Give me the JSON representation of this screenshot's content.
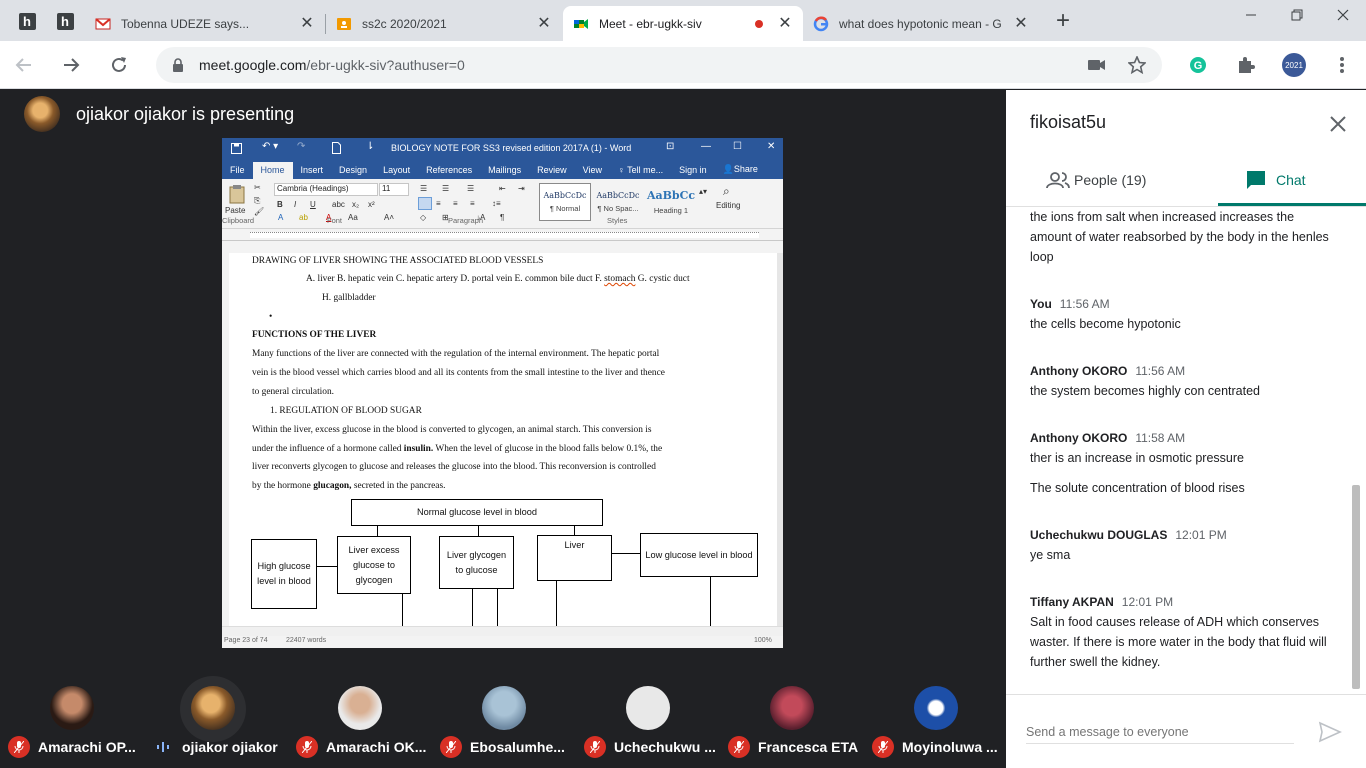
{
  "browser": {
    "pinned_tabs": [
      {
        "letter": "h"
      },
      {
        "letter": "h"
      }
    ],
    "tabs": [
      {
        "title": "Tobenna UDEZE says...",
        "icon": "gmail-icon"
      },
      {
        "title": "ss2c 2020/2021",
        "icon": "classroom-icon"
      },
      {
        "title": "Meet - ebr-ugkk-siv",
        "icon": "meet-icon",
        "active": true,
        "recording": true
      },
      {
        "title": "what does hypotonic mean - G",
        "icon": "google-icon"
      }
    ],
    "url_host": "meet.google.com",
    "url_path": "/ebr-ugkk-siv?authuser=0",
    "profile_label": "2021"
  },
  "meet": {
    "presenter_text": "ojiakor ojiakor is presenting",
    "participants": [
      {
        "name": "Amarachi OP...",
        "muted": true
      },
      {
        "name": "ojiakor ojiakor",
        "muted": false
      },
      {
        "name": "Amarachi OK...",
        "muted": true
      },
      {
        "name": "Ebosalumhe...",
        "muted": true
      },
      {
        "name": "Uchechukwu ...",
        "muted": true
      },
      {
        "name": "Francesca ETA",
        "muted": true
      },
      {
        "name": "Moyinoluwa ...",
        "muted": true
      }
    ]
  },
  "word": {
    "title": "BIOLOGY NOTE  FOR SS3 revised edition 2017A (1) - Word",
    "tabs": [
      "File",
      "Home",
      "Insert",
      "Design",
      "Layout",
      "References",
      "Mailings",
      "Review",
      "View"
    ],
    "tell_me": "Tell me...",
    "sign_in": "Sign in",
    "share": "Share",
    "font_name": "Cambria (Headings)",
    "font_size": "11",
    "groups": {
      "clipboard": "Clipboard",
      "font": "Font",
      "paragraph": "Paragraph",
      "styles": "Styles"
    },
    "paste": "Paste",
    "editing": "Editing",
    "styles": [
      {
        "sample": "AaBbCcDc",
        "name": "¶ Normal"
      },
      {
        "sample": "AaBbCcDc",
        "name": "¶ No Spac..."
      },
      {
        "sample": "AaBbCc",
        "name": "Heading 1"
      }
    ],
    "status_page": "Page 23 of 74",
    "status_words": "22407 words",
    "status_zoom": "100%",
    "doc": {
      "heading1": "DRAWING OF LIVER SHOWING THE ASSOCIATED BLOOD VESSELS",
      "list_a_1": "A.    liver B. hepatic vein C. hepatic artery D. portal vein E. common bile duct F. ",
      "list_a_stomach": "stomach",
      "list_a_2": " G. cystic duct",
      "list_a_3": "H. gallbladder",
      "bullet": "•",
      "functions_heading": "FUNCTIONS OF THE LIVER",
      "para1_l1": "Many functions of the liver are connected with the regulation of the internal environment. The hepatic portal",
      "para1_l2": "vein is the blood vessel which carries blood and all its contents from the small intestine to the liver and thence",
      "para1_l3": "to general circulation.",
      "sub_heading": "1.    REGULATION OF BLOOD SUGAR",
      "para2_l1": "Within the liver, excess glucose in the blood is converted to glycogen, an animal starch. This conversion is",
      "para2_l2a": "under the influence of a hormone called ",
      "para2_l2b": "insulin.",
      "para2_l2c": " When the level of glucose in the blood falls below 0.1%, the",
      "para2_l3": "liver reconverts glycogen to glucose and releases the glucose into the blood.  This reconversion is controlled",
      "para2_l4a": "by the hormone ",
      "para2_l4b": "glucagon,",
      "para2_l4c": " secreted in the pancreas.",
      "flow": {
        "normal": "Normal glucose level in blood",
        "high": "High glucose level in blood",
        "excess": "Liver excess glucose to glycogen",
        "glycogen": "Liver glycogen to glucose",
        "liver": "Liver",
        "low": "Low glucose level in blood"
      }
    }
  },
  "panel": {
    "title": "fikoisat5u",
    "people_tab": "People (19)",
    "chat_tab": "Chat",
    "messages": [
      {
        "sender": "",
        "time": "",
        "lines": [
          "the ions from salt when increased increases the amount of water reabsorbed by the body in the henles loop"
        ]
      },
      {
        "sender": "You",
        "time": "11:56 AM",
        "lines": [
          "the cells become hypotonic"
        ]
      },
      {
        "sender": "Anthony OKORO",
        "time": "11:56 AM",
        "lines": [
          "the system becomes highly con centrated"
        ]
      },
      {
        "sender": "Anthony OKORO",
        "time": "11:58 AM",
        "lines": [
          "ther is an increase in osmotic pressure",
          "The solute concentration of blood rises"
        ]
      },
      {
        "sender": "Uchechukwu DOUGLAS",
        "time": "12:01 PM",
        "lines": [
          "ye sma"
        ]
      },
      {
        "sender": "Tiffany AKPAN",
        "time": "12:01 PM",
        "lines": [
          "Salt in food causes release of ADH which conserves waster. If there is more water in the body that fluid will further swell the kidney."
        ]
      }
    ],
    "input_placeholder": "Send a message to everyone"
  },
  "colors": {
    "meet_dark": "#202124",
    "word_blue": "#2b579a",
    "chat_accent": "#00796b",
    "mute_red": "#d93025"
  }
}
